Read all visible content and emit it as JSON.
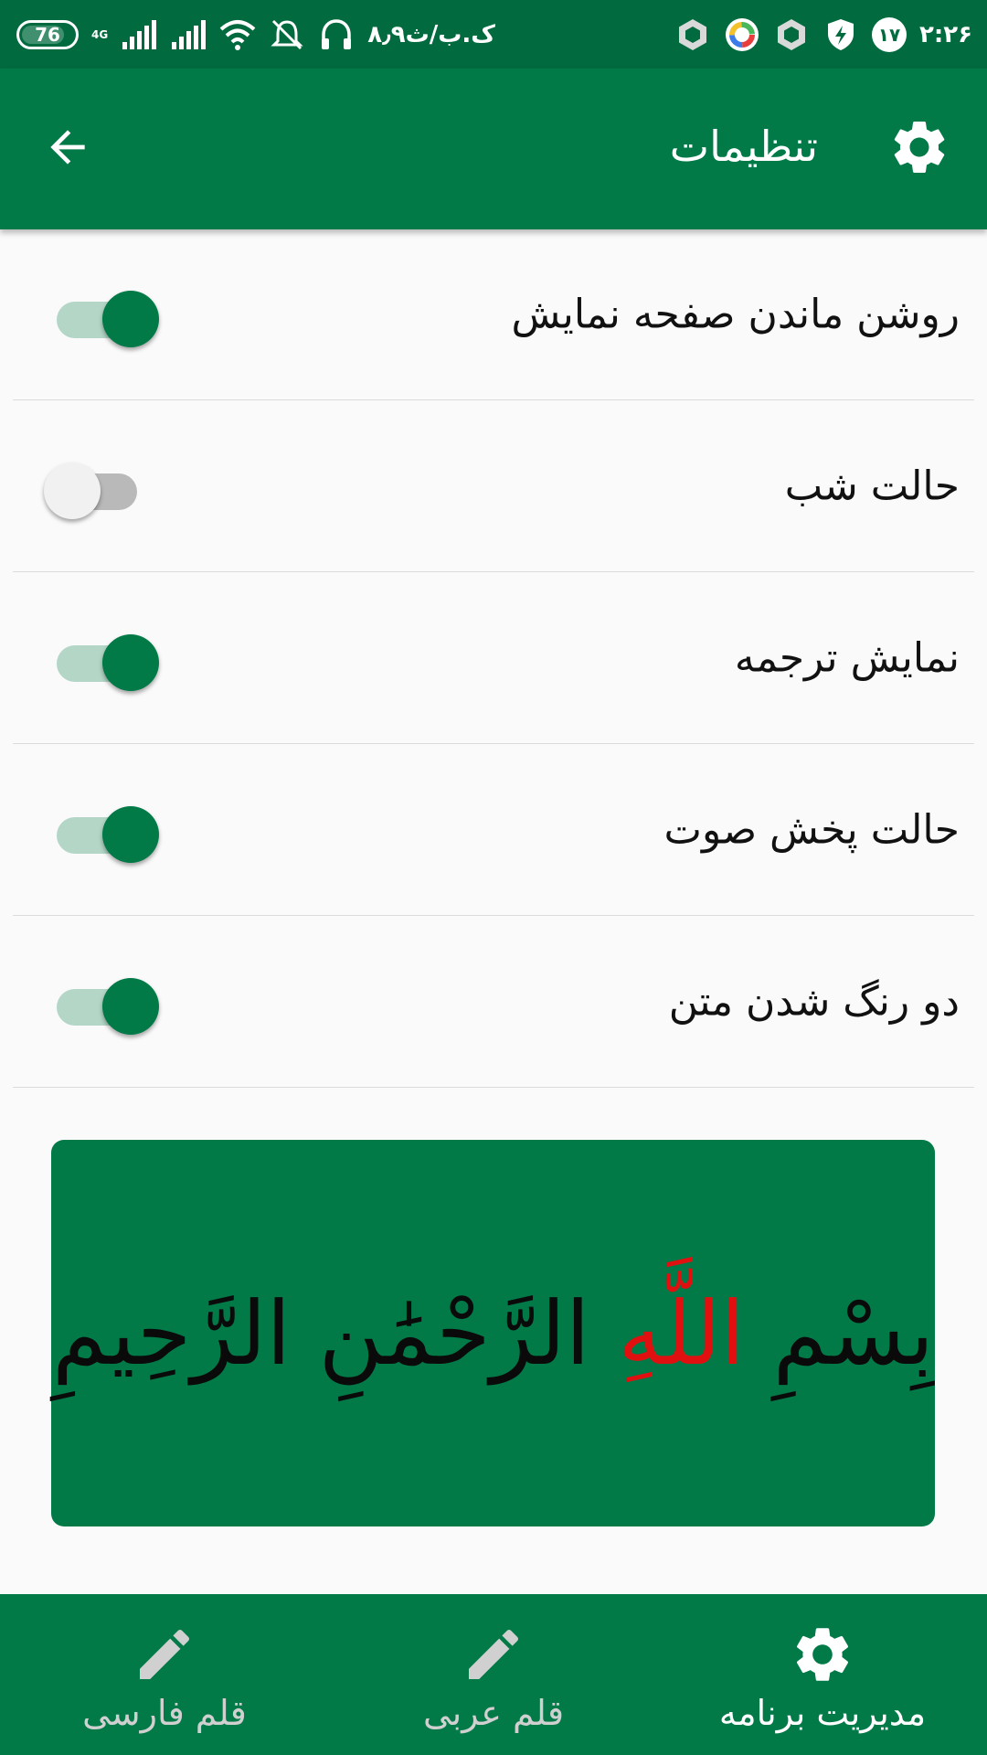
{
  "status_bar": {
    "battery_level": "76",
    "battery_fraction": 0.76,
    "network_type": "4G",
    "speed": "۸٫۹ک.ب/ث",
    "notification_badge": "۱۷",
    "clock": "۲:۲۶",
    "icons": [
      "wifi-icon",
      "signal-icon",
      "mute-icon",
      "headset-icon",
      "hexagon-app-icon",
      "color-wheel-app-icon",
      "vpn-shield-icon"
    ]
  },
  "app_bar": {
    "title": "تنظیمات",
    "back_icon": "arrow-left-icon",
    "settings_icon": "gear-icon"
  },
  "settings": [
    {
      "label": "روشن ماندن صفحه نمایش",
      "enabled": true
    },
    {
      "label": "حالت شب",
      "enabled": false
    },
    {
      "label": "نمایش ترجمه",
      "enabled": true
    },
    {
      "label": "حالت پخش صوت",
      "enabled": true
    },
    {
      "label": "دو رنگ شدن متن",
      "enabled": true
    }
  ],
  "preview": {
    "text_before": "بِسْمِ ",
    "text_highlight": "اللَّهِ",
    "text_after": " الرَّحْمَٰنِ الرَّحِيمِ",
    "highlight_color": "#e01010",
    "card_color": "#017A48"
  },
  "bottom_nav": {
    "items": [
      {
        "label": "قلم فارسی",
        "icon": "pencil-icon",
        "active": false
      },
      {
        "label": "قلم عربی",
        "icon": "pencil-icon",
        "active": false
      },
      {
        "label": "مدیریت برنامه",
        "icon": "gear-icon",
        "active": true
      }
    ]
  },
  "colors": {
    "primary": "#017A48",
    "primary_dark": "#016A3F",
    "track_on": "#b3d6c7",
    "background": "#fafafa"
  }
}
